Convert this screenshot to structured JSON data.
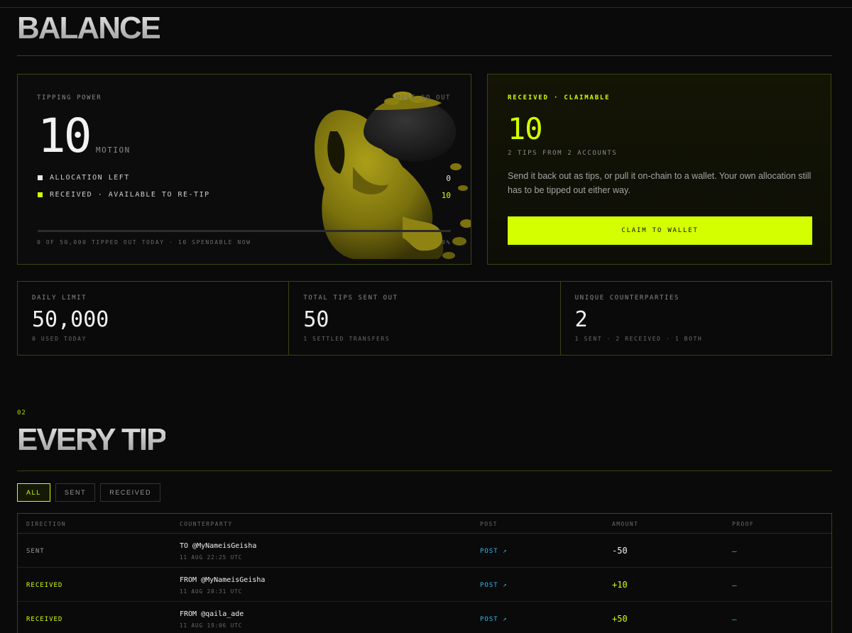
{
  "balance": {
    "title": "BALANCE",
    "power": {
      "label": "TIPPING POWER",
      "must_label": "MUST GO OUT",
      "value": "10",
      "unit": "MOTION",
      "legend": [
        {
          "label": "ALLOCATION LEFT",
          "value": "0",
          "color": "#e8e8e8"
        },
        {
          "label": "RECEIVED · AVAILABLE TO RE-TIP",
          "value": "10",
          "color": "#d4ff00"
        }
      ],
      "progress": 0,
      "footnote": "0 OF 50,000 TIPPED OUT TODAY · 10 SPENDABLE NOW",
      "percent": "0%"
    },
    "claim": {
      "label": "RECEIVED · CLAIMABLE",
      "value": "10",
      "sub": "2 TIPS FROM 2 ACCOUNTS",
      "description": "Send it back out as tips, or pull it on-chain to a wallet. Your own allocation still has to be tipped out either way.",
      "button": "CLAIM TO WALLET"
    },
    "stats": [
      {
        "label": "DAILY LIMIT",
        "value": "50,000",
        "note": "0 USED TODAY"
      },
      {
        "label": "TOTAL TIPS SENT OUT",
        "value": "50",
        "note": "1 SETTLED TRANSFERS"
      },
      {
        "label": "UNIQUE COUNTERPARTIES",
        "value": "2",
        "note": "1 SENT · 2 RECEIVED · 1 BOTH"
      }
    ]
  },
  "tips": {
    "section_number": "02",
    "title": "EVERY TIP",
    "filters": [
      "ALL",
      "SENT",
      "RECEIVED"
    ],
    "active_filter": "ALL",
    "columns": [
      "DIRECTION",
      "COUNTERPARTY",
      "POST",
      "AMOUNT",
      "PROOF"
    ],
    "rows": [
      {
        "direction": "SENT",
        "counterparty": "TO @MyNameisGeisha",
        "date": "11 AUG 22:25 UTC",
        "post": "POST ↗",
        "amount": "-50",
        "proof": "—"
      },
      {
        "direction": "RECEIVED",
        "counterparty": "FROM @MyNameisGeisha",
        "date": "11 AUG 20:31 UTC",
        "post": "POST ↗",
        "amount": "+10",
        "proof": "—"
      },
      {
        "direction": "RECEIVED",
        "counterparty": "FROM @qaila_ade",
        "date": "11 AUG 19:06 UTC",
        "post": "POST ↗",
        "amount": "+50",
        "proof": "—"
      }
    ]
  },
  "colors": {
    "accent": "#d4ff00",
    "link": "#38b6e8",
    "border": "#3a4410"
  },
  "icons": {
    "mascot": "hooded-figure-with-coin-sack-illustration",
    "post_link": "arrow-up-right-icon"
  }
}
